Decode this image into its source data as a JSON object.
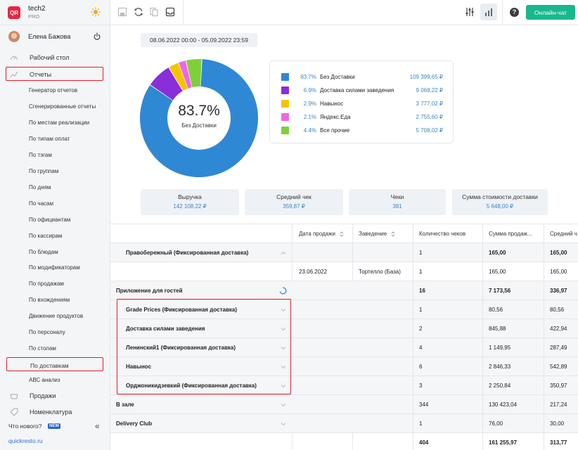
{
  "brand": {
    "logo": "QR",
    "name": "tech2",
    "plan": "PRO",
    "theme_icon": "sun-icon"
  },
  "user": {
    "name": "Елена Бажова",
    "power_icon": "power-icon"
  },
  "nav": {
    "desktop": "Рабочий стол",
    "reports": "Отчеты",
    "report_items": [
      "Генератор отчетов",
      "Сгенерированные отчеты",
      "По местам реализации",
      "По типам оплат",
      "По тэгам",
      "По группам",
      "По дням",
      "По часам",
      "По официантам",
      "По кассирам",
      "По блюдам",
      "По модификаторам",
      "По продажам",
      "По вхождениям",
      "Движение продуктов",
      "По персоналу",
      "По столам",
      "По доставкам",
      "АВС анализ"
    ],
    "sales": "Продажи",
    "nomenclature": "Номенклатура",
    "whats_new": "Что нового?",
    "new_badge": "NEW",
    "collapse": "«",
    "site": "quickresto.ru"
  },
  "topbar": {
    "chat_button": "Онлайн-чат",
    "help": "?"
  },
  "date_range": "08.06.2022 00:00 - 05.09.2022 23:59",
  "donut": {
    "percent": "83.7%",
    "label": "Без Доставки"
  },
  "chart_data": {
    "type": "pie",
    "title": "",
    "categories": [
      "Без Доставки",
      "Доставка силами заведения",
      "Навынос",
      "Яндекс.Еда",
      "Все прочие"
    ],
    "values": [
      109399.65,
      9068.22,
      3777.02,
      2755.6,
      5708.02
    ],
    "percents": [
      83.7,
      6.9,
      2.9,
      2.1,
      4.4
    ],
    "colors": [
      "#2f88d4",
      "#8a2ddb",
      "#f5c400",
      "#ee66e6",
      "#7fcf3a"
    ]
  },
  "legend": [
    {
      "pct": "83.7%",
      "name": "Без Доставки",
      "value": "109 399,65 ₽"
    },
    {
      "pct": "6.9%",
      "name": "Доставка силами заведения",
      "value": "9 068,22 ₽"
    },
    {
      "pct": "2.9%",
      "name": "Навынос",
      "value": "3 777,02 ₽"
    },
    {
      "pct": "2.1%",
      "name": "Яндекс.Еда",
      "value": "2 755,60 ₽"
    },
    {
      "pct": "4.4%",
      "name": "Все прочие",
      "value": "5 708,02 ₽"
    }
  ],
  "stats": [
    {
      "title": "Выручка",
      "value": "142 108,22 ₽"
    },
    {
      "title": "Средний чек",
      "value": "359,87 ₽"
    },
    {
      "title": "Чеки",
      "value": "381"
    },
    {
      "title": "Сумма стоимости доставки",
      "value": "5 648,00 ₽"
    }
  ],
  "table": {
    "headers": [
      "Дата продажи",
      "Заведение",
      "Количество чеков",
      "Сумма продаж...",
      "Средний ч"
    ],
    "rows": [
      {
        "name": "Правобережный (Фиксированная доставка)",
        "date": "",
        "venue": "",
        "count": "1",
        "sum": "165,00",
        "avg": "165,00"
      },
      {
        "name": "",
        "date": "23.06.2022",
        "venue": "Тортелло (База)",
        "count": "1",
        "sum": "165,00",
        "avg": "165,00"
      },
      {
        "name": "Приложение для гостей",
        "date": "",
        "venue": "",
        "count": "16",
        "sum": "7 173,56",
        "avg": "336,97"
      },
      {
        "name": "Grade Prices (Фиксированная доставка)",
        "date": "",
        "venue": "",
        "count": "1",
        "sum": "80,56",
        "avg": "80,56"
      },
      {
        "name": "Доставка силами заведения",
        "date": "",
        "venue": "",
        "count": "2",
        "sum": "845,88",
        "avg": "422,94"
      },
      {
        "name": "Ленинский1 (Фиксированная доставка)",
        "date": "",
        "venue": "",
        "count": "4",
        "sum": "1 149,95",
        "avg": "287,49"
      },
      {
        "name": "Навынос",
        "date": "",
        "venue": "",
        "count": "6",
        "sum": "2 846,33",
        "avg": "542,89"
      },
      {
        "name": "Орджоникидзевкий (Фиксированная доставка)",
        "date": "",
        "venue": "",
        "count": "3",
        "sum": "2 250,84",
        "avg": "350,97"
      },
      {
        "name": "В зале",
        "date": "",
        "venue": "",
        "count": "344",
        "sum": "130 423,04",
        "avg": "217,24"
      },
      {
        "name": "Delivery Club",
        "date": "",
        "venue": "",
        "count": "1",
        "sum": "76,00",
        "avg": "30,00"
      },
      {
        "name": "",
        "date": "",
        "venue": "",
        "count": "404",
        "sum": "161 255,97",
        "avg": "313,77"
      }
    ]
  }
}
